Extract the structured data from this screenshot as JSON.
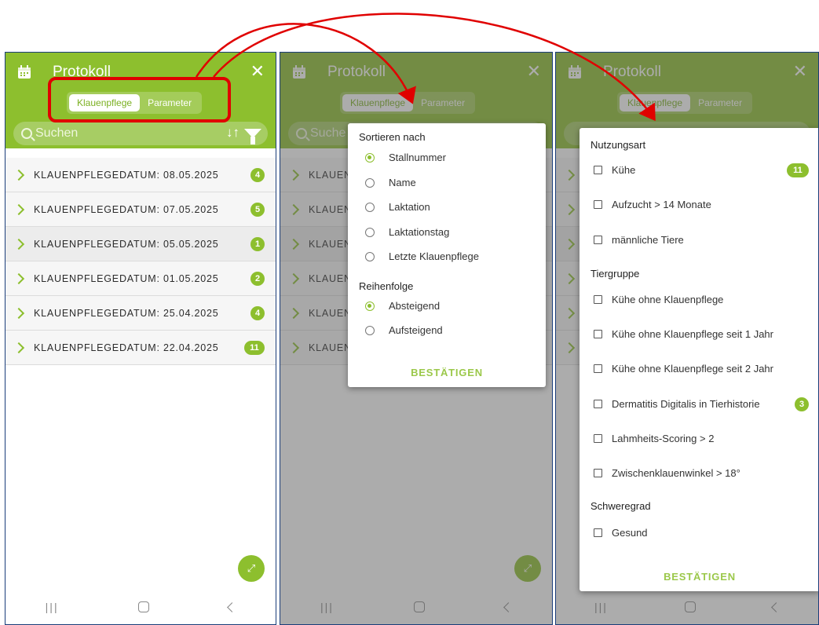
{
  "screens": [
    {
      "title": "Protokoll",
      "tabs": [
        "Klauenpflege",
        "Parameter"
      ],
      "search_placeholder": "Suchen",
      "sort_icon": "↓↑",
      "rows": [
        {
          "label": "KLAUENPFLEGEDATUM: 08.05.2025",
          "count": "4"
        },
        {
          "label": "KLAUENPFLEGEDATUM: 07.05.2025",
          "count": "5"
        },
        {
          "label": "KLAUENPFLEGEDATUM: 05.05.2025",
          "count": "1"
        },
        {
          "label": "KLAUENPFLEGEDATUM: 01.05.2025",
          "count": "2"
        },
        {
          "label": "KLAUENPFLEGEDATUM: 25.04.2025",
          "count": "4"
        },
        {
          "label": "KLAUENPFLEGEDATUM: 22.04.2025",
          "count": "11"
        }
      ]
    },
    {
      "title": "Protokoll",
      "tabs": [
        "Klauenpflege",
        "Parameter"
      ],
      "search_placeholder": "Suche",
      "rows_truncated": [
        "KLAUEN",
        "KLAUEN",
        "KLAUEN",
        "KLAUEN",
        "KLAUEN",
        "KLAUEN"
      ]
    },
    {
      "title": "Protokoll",
      "tabs": [
        "Klauenpflege",
        "Parameter"
      ]
    }
  ],
  "sort_dialog": {
    "sort_title": "Sortieren nach",
    "sort_options": [
      {
        "label": "Stallnummer",
        "selected": true
      },
      {
        "label": "Name",
        "selected": false
      },
      {
        "label": "Laktation",
        "selected": false
      },
      {
        "label": "Laktationstag",
        "selected": false
      },
      {
        "label": "Letzte Klauenpflege",
        "selected": false
      }
    ],
    "order_title": "Reihenfolge",
    "order_options": [
      {
        "label": "Absteigend",
        "selected": true
      },
      {
        "label": "Aufsteigend",
        "selected": false
      }
    ],
    "confirm": "BESTÄTIGEN"
  },
  "filter_dialog": {
    "sections": [
      {
        "title": "Nutzungsart",
        "items": [
          {
            "label": "Kühe",
            "count": "11"
          },
          {
            "label": "Aufzucht > 14 Monate",
            "count": ""
          },
          {
            "label": "männliche Tiere",
            "count": ""
          }
        ]
      },
      {
        "title": "Tiergruppe",
        "items": [
          {
            "label": "Kühe ohne Klauenpflege",
            "count": ""
          },
          {
            "label": "Kühe ohne Klauenpflege seit 1 Jahr",
            "count": ""
          },
          {
            "label": "Kühe ohne Klauenpflege seit 2 Jahr",
            "count": ""
          },
          {
            "label": "Dermatitis Digitalis in Tierhistorie",
            "count": "3"
          },
          {
            "label": "Lahmheits-Scoring > 2",
            "count": ""
          },
          {
            "label": "Zwischenklauenwinkel > 18°",
            "count": ""
          }
        ]
      },
      {
        "title": "Schweregrad",
        "items": [
          {
            "label": "Gesund",
            "count": ""
          }
        ]
      }
    ],
    "confirm": "BESTÄTIGEN"
  },
  "colors": {
    "primary": "#8dbf2e",
    "annotation": "#e00000"
  }
}
